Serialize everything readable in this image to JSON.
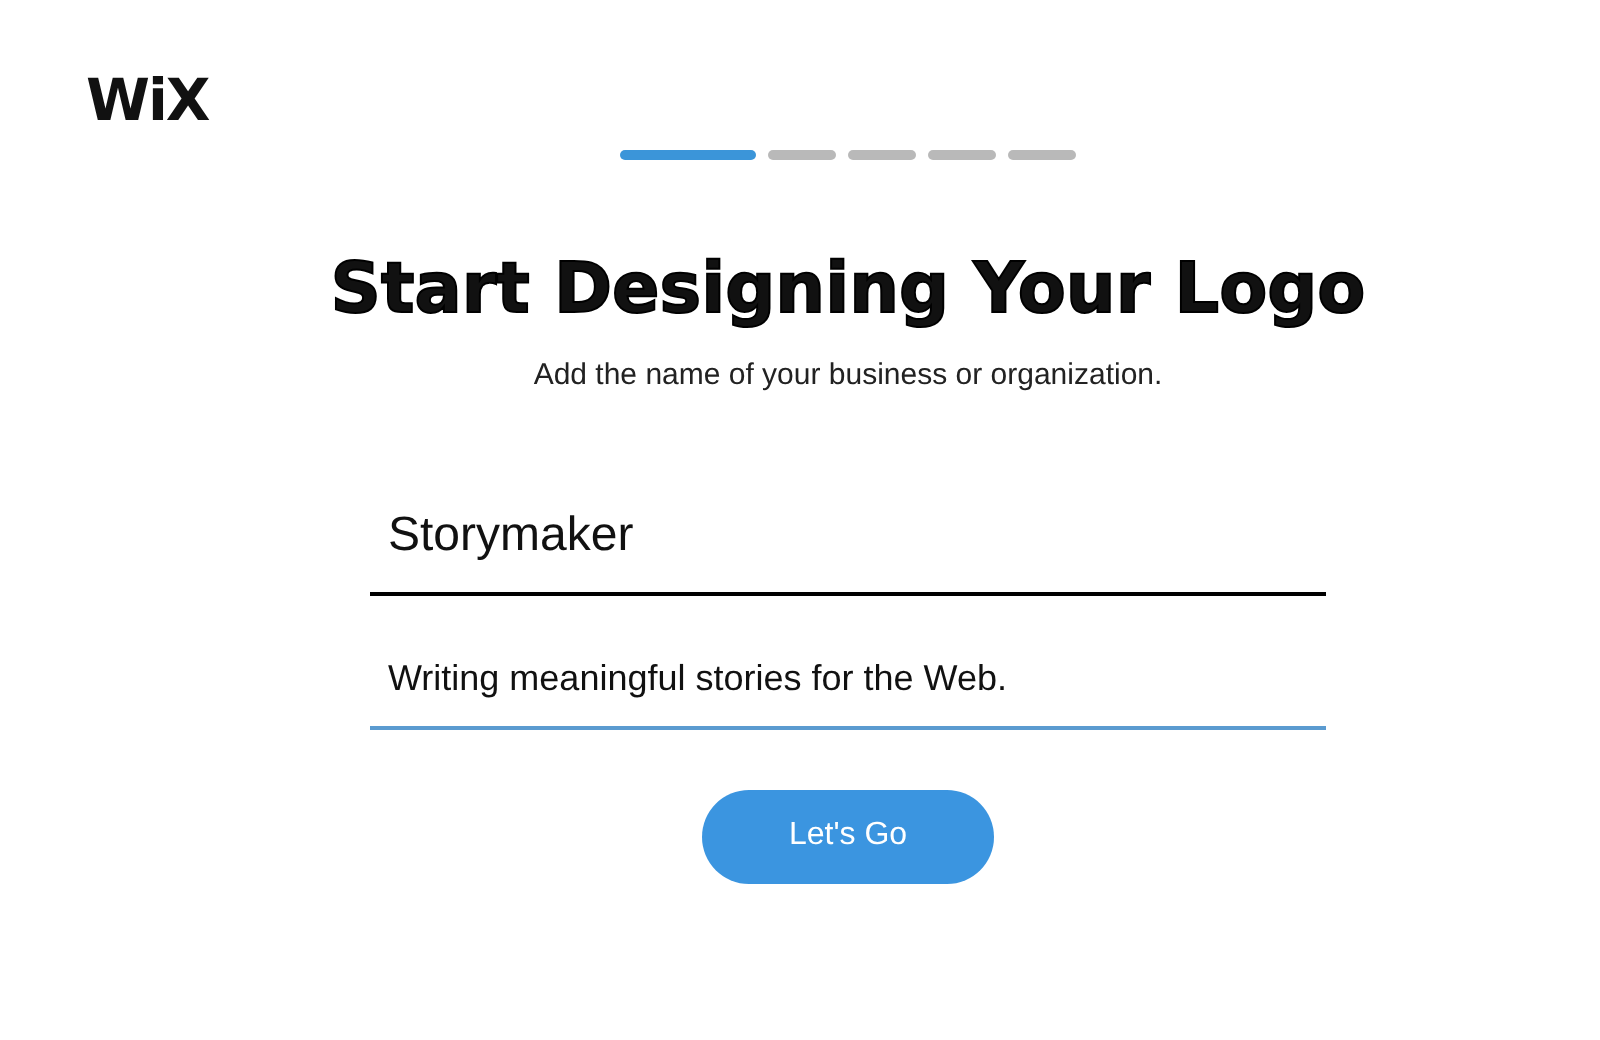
{
  "logo": "WiX",
  "steps": [
    {
      "selected": true
    },
    {
      "selected": false
    },
    {
      "selected": false
    },
    {
      "selected": false
    },
    {
      "selected": false
    }
  ],
  "title": "Start Designing Your Logo",
  "subtitle": "Add the name of your business or organization.",
  "fields": [
    {
      "kind": "name",
      "value": "Storymaker",
      "focused": false
    },
    {
      "kind": "tagline",
      "value": "Writing meaningful stories for the Web.",
      "focused": true
    }
  ],
  "button": "Let's Go"
}
